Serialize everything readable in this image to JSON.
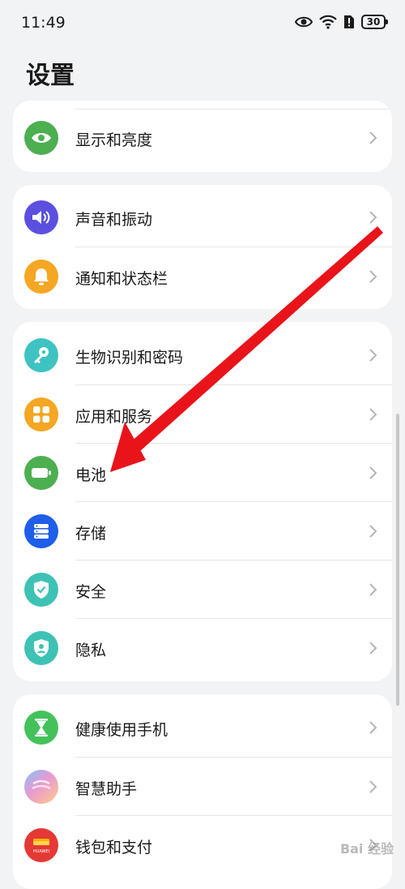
{
  "status": {
    "time": "11:49",
    "battery": "30"
  },
  "title": "设置",
  "cards": [
    {
      "items": [
        {
          "label": "显示和亮度",
          "icon": "eye-icon",
          "color": "#4caf50"
        }
      ]
    },
    {
      "items": [
        {
          "label": "声音和振动",
          "icon": "speaker-icon",
          "color": "#5b4fe0"
        },
        {
          "label": "通知和状态栏",
          "icon": "bell-icon",
          "color": "#f5a623"
        }
      ]
    },
    {
      "items": [
        {
          "label": "生物识别和密码",
          "icon": "key-icon",
          "color": "#3ec2c2"
        },
        {
          "label": "应用和服务",
          "icon": "apps-icon",
          "color": "#f5a623"
        },
        {
          "label": "电池",
          "icon": "battery-icon",
          "color": "#4caf50"
        },
        {
          "label": "存储",
          "icon": "storage-icon",
          "color": "#1e5eea"
        },
        {
          "label": "安全",
          "icon": "shield-check-icon",
          "color": "#3ec2b4"
        },
        {
          "label": "隐私",
          "icon": "privacy-shield-icon",
          "color": "#3ec2b4"
        }
      ]
    },
    {
      "items": [
        {
          "label": "健康使用手机",
          "icon": "hourglass-icon",
          "color": "#43c25a"
        },
        {
          "label": "智慧助手",
          "icon": "assistant-icon",
          "color": "#e89ad0"
        },
        {
          "label": "钱包和支付",
          "icon": "wallet-icon",
          "color": "#e53935"
        }
      ]
    }
  ],
  "wallet_icon_text": "HUAWEI",
  "watermark": "Bai 经验",
  "annotation_color": "#e8141a"
}
